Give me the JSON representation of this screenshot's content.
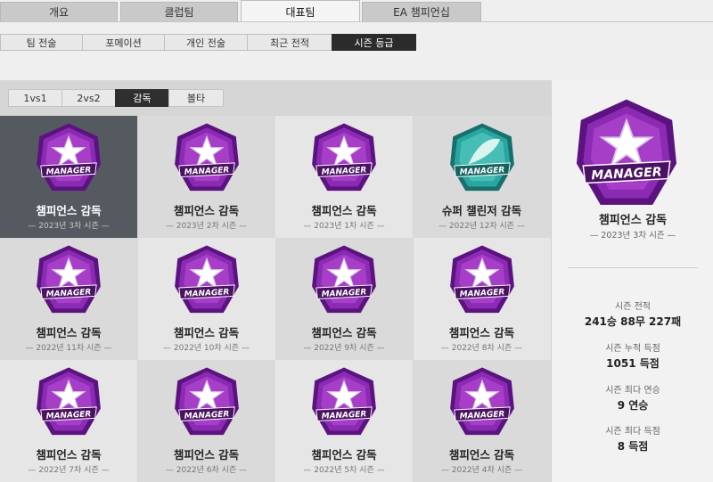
{
  "top_tabs": [
    "개요",
    "클럽팀",
    "대표팀",
    "EA 챔피언십"
  ],
  "top_tab_active": "대표팀",
  "sub_tabs": [
    "팀 전술",
    "포메이션",
    "개인 전술",
    "최근 전적",
    "시즌 등급"
  ],
  "sub_tab_active": "시즌 등급",
  "mode_tabs": [
    "1vs1",
    "2vs2",
    "감독",
    "볼타"
  ],
  "mode_tab_active": "감독",
  "badge_text": "MANAGER",
  "colors": {
    "champion_purple": "#8b2bb3",
    "challenger_teal": "#2aa6a1",
    "selected_bg": "#555a60"
  },
  "seasons": [
    {
      "name": "챔피언스 감독",
      "season": "2023년 3차 시즌",
      "tier": "champion"
    },
    {
      "name": "챔피언스 감독",
      "season": "2023년 2차 시즌",
      "tier": "champion"
    },
    {
      "name": "챔피언스 감독",
      "season": "2023년 1차 시즌",
      "tier": "champion"
    },
    {
      "name": "슈퍼 챌린저 감독",
      "season": "2022년 12차 시즌",
      "tier": "challenger"
    },
    {
      "name": "챔피언스 감독",
      "season": "2022년 11차 시즌",
      "tier": "champion"
    },
    {
      "name": "챔피언스 감독",
      "season": "2022년 10차 시즌",
      "tier": "champion"
    },
    {
      "name": "챔피언스 감독",
      "season": "2022년 9차 시즌",
      "tier": "champion"
    },
    {
      "name": "챔피언스 감독",
      "season": "2022년 8차 시즌",
      "tier": "champion"
    },
    {
      "name": "챔피언스 감독",
      "season": "2022년 7차 시즌",
      "tier": "champion"
    },
    {
      "name": "챔피언스 감독",
      "season": "2022년 6차 시즌",
      "tier": "champion"
    },
    {
      "name": "챔피언스 감독",
      "season": "2022년 5차 시즌",
      "tier": "champion"
    },
    {
      "name": "챔피언스 감독",
      "season": "2022년 4차 시즌",
      "tier": "champion"
    }
  ],
  "selected_index": 0,
  "detail": {
    "name": "챔피언스 감독",
    "season": "2023년 3차 시즌",
    "stats": [
      {
        "label": "시즌 전적",
        "value": "241승 88무 227패"
      },
      {
        "label": "시즌 누적 득점",
        "value": "1051 득점"
      },
      {
        "label": "시즌 최다 연승",
        "value": "9 연승"
      },
      {
        "label": "시즌 최다 득점",
        "value": "8 득점"
      }
    ]
  }
}
